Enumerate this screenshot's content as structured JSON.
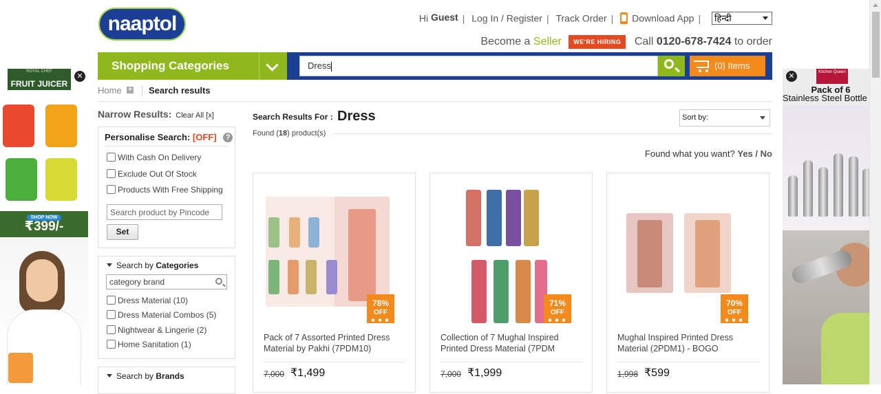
{
  "header": {
    "logo_text": "naaptol",
    "hi": "Hi",
    "guest": "Guest",
    "login": "Log In / Register",
    "track_order": "Track Order",
    "download_app": "Download App",
    "language": "हिन्दी",
    "become_a": "Become a",
    "seller": "Seller",
    "hiring": "WE'RE HIRING",
    "call": "Call",
    "phone": "0120-678-7424",
    "to_order": "to order"
  },
  "nav": {
    "shopping_categories": "Shopping Categories",
    "search_value": "Dress",
    "cart_label": "(0) Items"
  },
  "breadcrumb": {
    "home": "Home",
    "current": "Search results"
  },
  "filters": {
    "narrow_results": "Narrow Results:",
    "clear_all": "Clear All [x]",
    "personalise": "Personalise Search:",
    "personalise_state": "[OFF]",
    "options": [
      "With Cash On Delivery",
      "Exclude Out Of Stock",
      "Products With Free Shipping"
    ],
    "pincode_placeholder": "Search product by Pincode",
    "set_label": "Set",
    "search_by": "Search by",
    "categories_word": "Categories",
    "category_placeholder": "category brand",
    "categories": [
      "Dress Material (10)",
      "Dress Material Combos (5)",
      "Nightwear & Lingerie (2)",
      "Home Sanitation (1)"
    ],
    "brands_word": "Brands"
  },
  "results": {
    "search_results_for": "Search Results For :",
    "query": "Dress",
    "found_prefix": "Found (",
    "found_count": "18",
    "found_suffix": ") product(s)",
    "sort_by": "Sort by:",
    "found_what": "Found what you want?",
    "yes": "Yes",
    "slash": "/",
    "no": "No"
  },
  "products": [
    {
      "title": "Pack of 7 Assorted Printed Dress Material by Pakhi (7PDM10)",
      "mrp": "7,000",
      "price": "₹1,499",
      "off_pct": "78%",
      "off": "OFF"
    },
    {
      "title": "Collection of 7 Mughal Inspired Printed Dress Material (7PDM",
      "mrp": "7,000",
      "price": "₹1,999",
      "off_pct": "71%",
      "off": "OFF"
    },
    {
      "title": "Mughal Inspired Printed Dress Material (2PDM1) - BOGO",
      "mrp": "1,998",
      "price": "₹599",
      "off_pct": "70%",
      "off": "OFF"
    }
  ],
  "left_ad": {
    "brand_small": "ROYAL CHEF",
    "brand": "FRUIT JUICER",
    "shop_now": "SHOP NOW",
    "price": "₹399/-"
  },
  "right_ad": {
    "brand": "Kitchen Queen",
    "line1": "Pack of 6",
    "line2": "Stainless Steel Bottle"
  },
  "colors": {
    "navy": "#1b3f92",
    "green": "#8fb81c",
    "orange": "#f48a1c",
    "red": "#e34a21"
  }
}
